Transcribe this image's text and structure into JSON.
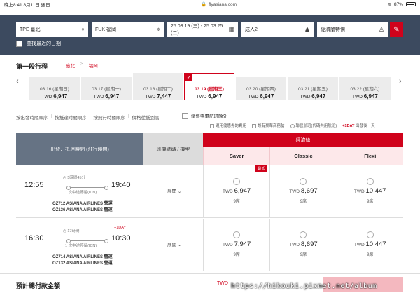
{
  "status": {
    "time": "晚上8:41",
    "date": "8月11日 週日",
    "url": "flyasiana.com",
    "battery": "87%"
  },
  "search": {
    "origin": "TPE 臺北",
    "destination": "FUK 福岡",
    "dates": "25.03.19 (三) - 25.03.25 (二)",
    "passengers": "成人2",
    "cabin": "經濟艙特價",
    "recent_label": "查找最近的日期"
  },
  "leg": {
    "title": "第一段行程",
    "from": "臺北",
    "sep": ">",
    "to": "福岡"
  },
  "dates": [
    {
      "label": "03.16 (星期日)",
      "currency": "TWD",
      "price": "6,947"
    },
    {
      "label": "03.17 (星期一)",
      "currency": "TWD",
      "price": "6,947"
    },
    {
      "label": "03.18 (星期二)",
      "currency": "TWD",
      "price": "7,447"
    },
    {
      "label": "03.19 (星期三)",
      "currency": "TWD",
      "price": "6,947"
    },
    {
      "label": "03.20 (星期四)",
      "currency": "TWD",
      "price": "6,947"
    },
    {
      "label": "03.21 (星期五)",
      "currency": "TWD",
      "price": "6,947"
    },
    {
      "label": "03.22 (星期六)",
      "currency": "TWD",
      "price": "6,947"
    }
  ],
  "sort": {
    "options": [
      "按出發時間順序",
      "按抵達時間順序",
      "按飛行時間順序",
      "價格從低到高"
    ],
    "exclude_soldout": "銷售完畢航班除外"
  },
  "legend": {
    "discount": "適用優惠券的費用",
    "business": "設有豪華商務艙",
    "codeshare": "聯營航班(代碼共用航班)",
    "plusday_tag": "+1DAY",
    "plusday_desc": "出發後一天"
  },
  "table": {
    "col_dep": "出發．抵達時間 (飛行時間)",
    "col_flight": "班機號碼 / 機型",
    "col_class": "經濟艙",
    "fares": [
      "Saver",
      "Classic",
      "Flexi"
    ]
  },
  "flights": [
    {
      "dep": "12:55",
      "arr": "19:40",
      "duration": "5時間45分",
      "stop": "1 次中途停留(ICN)",
      "plusday": "",
      "op1": "OZ712 ASIANA AIRLINES 營運",
      "op2": "OZ136 ASIANA AIRLINES 營運",
      "expand": "展開",
      "prices": [
        {
          "currency": "TWD",
          "amount": "6,947",
          "seats": "9席",
          "badge": "最低"
        },
        {
          "currency": "TWD",
          "amount": "8,697",
          "seats": "9席",
          "badge": ""
        },
        {
          "currency": "TWD",
          "amount": "10,447",
          "seats": "9席",
          "badge": ""
        }
      ]
    },
    {
      "dep": "16:30",
      "arr": "10:30",
      "duration": "17時間",
      "stop": "1 次中途停留(ICN)",
      "plusday": "+1DAY",
      "op1": "OZ714 ASIANA AIRLINES 營運",
      "op2": "OZ132 ASIANA AIRLINES 營運",
      "expand": "展開",
      "prices": [
        {
          "currency": "TWD",
          "amount": "7,947",
          "seats": "9席",
          "badge": ""
        },
        {
          "currency": "TWD",
          "amount": "8,697",
          "seats": "9席",
          "badge": ""
        },
        {
          "currency": "TWD",
          "amount": "10,447",
          "seats": "9席",
          "badge": ""
        }
      ]
    }
  ],
  "footer": {
    "label": "預計總付款金額",
    "currency": "TWD"
  },
  "watermark": "https://hikouki.pixnet.net/album"
}
